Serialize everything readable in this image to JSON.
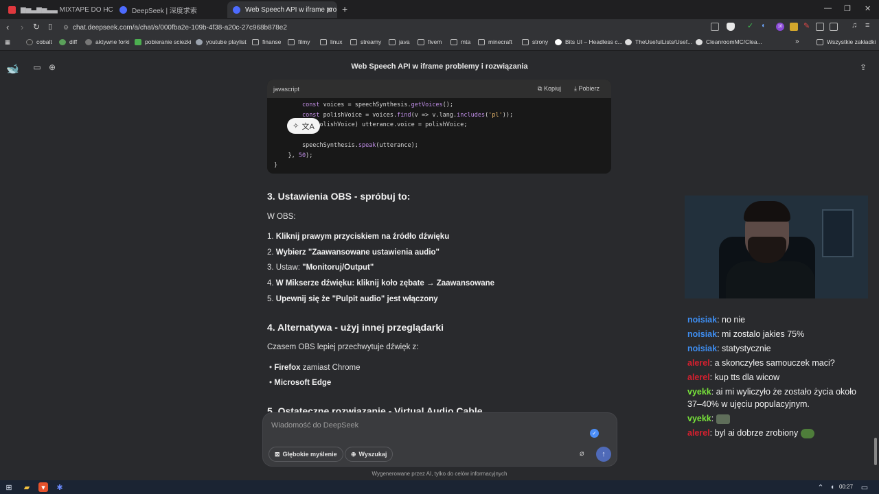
{
  "tabs": [
    {
      "label": "▆▅▃▆▅▃▃ MIXTAPE DO HC",
      "color": "#e0383e"
    },
    {
      "label": "DeepSeek | 深度求索",
      "color": "#4d6bfe"
    },
    {
      "label": "Web Speech API w iframe proble",
      "color": "#4d6bfe"
    }
  ],
  "address": {
    "url": "chat.deepseek.com/a/chat/s/000fba2e-109b-4f38-a20c-27c968b878e2"
  },
  "extensions": {
    "badge_count": "10"
  },
  "bookmarks": [
    "cobalt",
    "diff",
    "aktywne forki",
    "pobieranie sciezki",
    "youtube playlist",
    "finanse",
    "filmy",
    "linux",
    "streamy",
    "java",
    "fivem",
    "mta",
    "minecraft",
    "strony",
    "Bits UI – Headless c...",
    "TheUsefulLists/Usef...",
    "CleanroomMC/Clea...",
    "»",
    "Wszystkie zakładki"
  ],
  "chat": {
    "title": "Web Speech API w iframe problemy i rozwiązania"
  },
  "code_block": {
    "lang": "javascript",
    "copy_label": "Kopiuj",
    "download_label": "Pobierz"
  },
  "sections": {
    "s3_title": "3. Ustawienia OBS - spróbuj to:",
    "s3_intro": "W OBS:",
    "s3_items": [
      {
        "num": "1.",
        "text": "Kliknij prawym przyciskiem na źródło dźwięku"
      },
      {
        "num": "2.",
        "text": "Wybierz \"Zaawansowane ustawienia audio\""
      },
      {
        "num": "3.",
        "pre": "Ustaw: ",
        "text": "\"Monitoruj/Output\""
      },
      {
        "num": "4.",
        "text": "W Mikserze dźwięku: kliknij koło zębate → Zaawansowane"
      },
      {
        "num": "5.",
        "text": "Upewnij się że \"Pulpit audio\" jest włączony"
      }
    ],
    "s4_title": "4. Alternatywa - użyj innej przeglądarki",
    "s4_intro": "Czasem OBS lepiej przechwytuje dźwięk z:",
    "s4_bullets": [
      {
        "bold": "Firefox",
        "rest": " zamiast Chrome"
      },
      {
        "bold": "Microsoft Edge",
        "rest": ""
      }
    ],
    "s5_title": "5. Ostateczne rozwiązanie - Virtual Audio Cable"
  },
  "composer": {
    "placeholder": "Wiadomość do DeepSeek",
    "deep_think": "Głębokie myślenie",
    "search": "Wyszukaj"
  },
  "disclaimer": "Wygenerowane przez AI, tylko do celów informacyjnych",
  "stream_chat": [
    {
      "user": "noisiak",
      "color": "#3e8df0",
      "text": "no nie"
    },
    {
      "user": "noisiak",
      "color": "#3e8df0",
      "text": "mi zostalo jakies 75%"
    },
    {
      "user": "noisiak",
      "color": "#3e8df0",
      "text": "statystycznie"
    },
    {
      "user": "alerel",
      "color": "#d6202f",
      "text": "a skonczyles samouczek maci?"
    },
    {
      "user": "alerel",
      "color": "#d6202f",
      "text": "kup tts dla wicow"
    },
    {
      "user": "vyekk",
      "color": "#78e43a",
      "text": "ai mi wyliczyło że zostało życia około 37–40% w ujęciu populacyjnym."
    },
    {
      "user": "vyekk",
      "color": "#78e43a",
      "text": ""
    },
    {
      "user": "alerel",
      "color": "#d6202f",
      "text": "byl ai dobrze zrobiony"
    }
  ],
  "taskbar": {
    "time": "00:27"
  }
}
